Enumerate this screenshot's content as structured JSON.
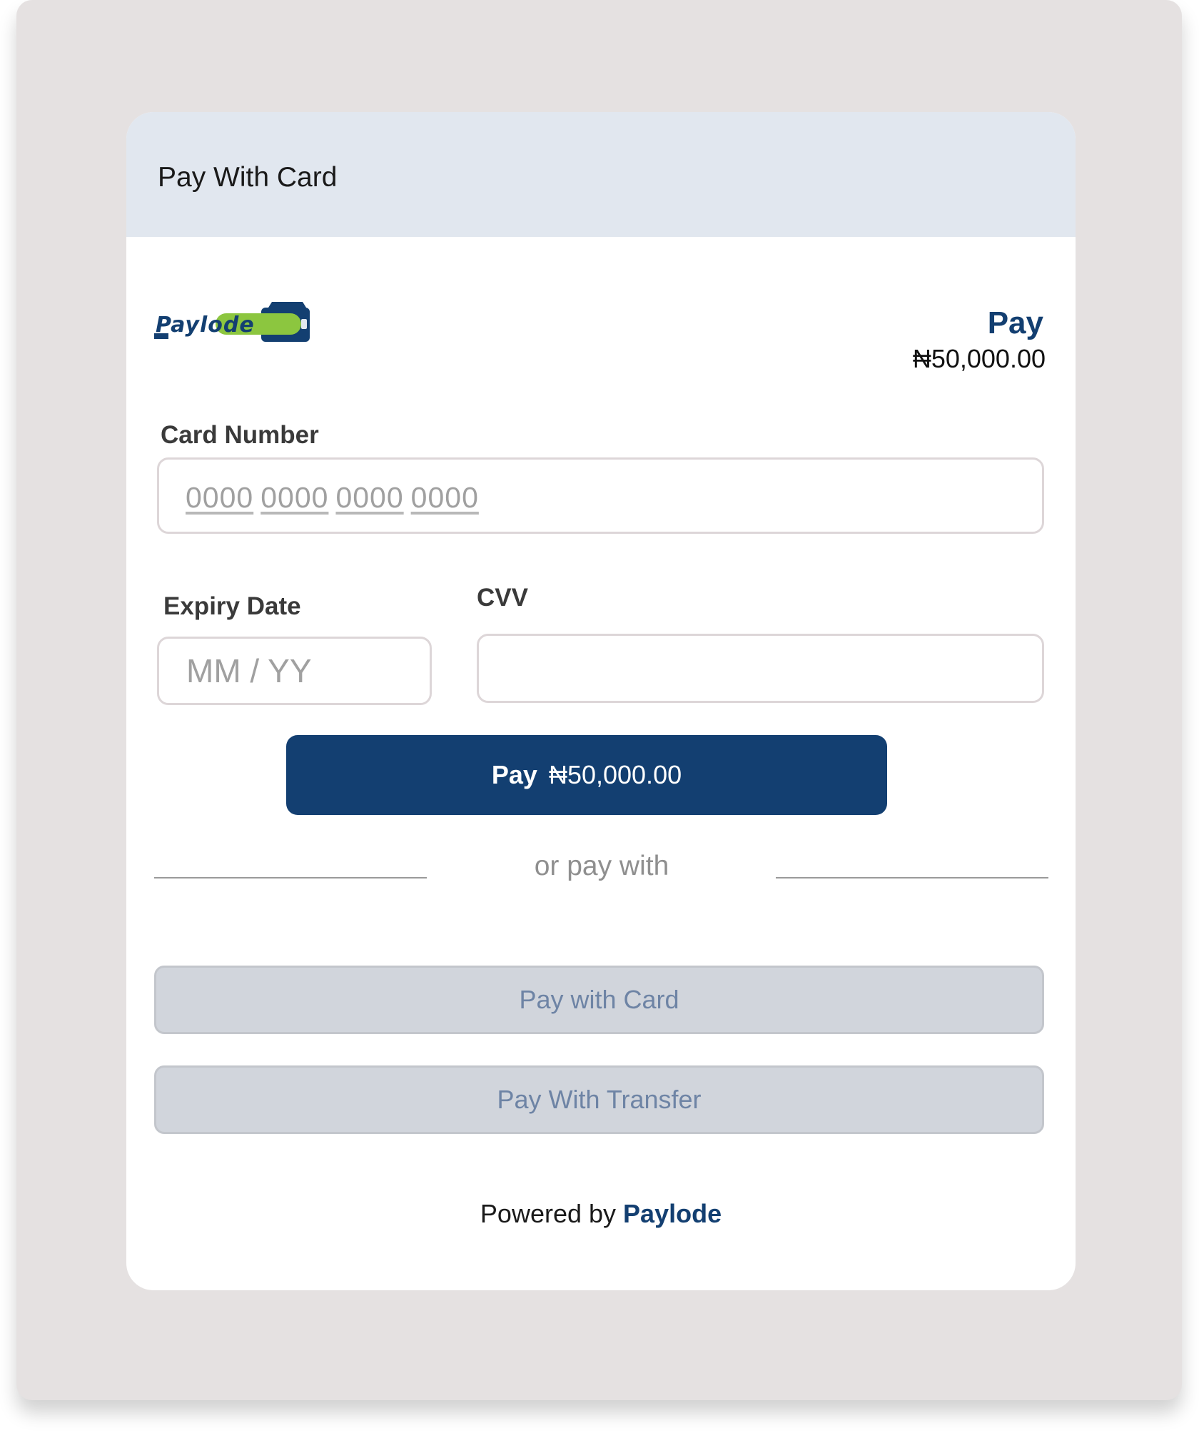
{
  "modal": {
    "title": "Pay With Card"
  },
  "brand": {
    "logo_text": "Paylode",
    "primary_color": "#133f71",
    "accent_color": "#8cc63f"
  },
  "summary": {
    "label": "Pay",
    "amount": "₦50,000.00"
  },
  "form": {
    "card_number_label": "Card Number",
    "card_number_placeholder_groups": [
      "0000",
      "0000",
      "0000",
      "0000"
    ],
    "expiry_label": "Expiry Date",
    "expiry_placeholder": "MM / YY",
    "cvv_label": "CVV",
    "cvv_value": ""
  },
  "submit": {
    "label": "Pay",
    "amount": "₦50,000.00"
  },
  "divider": {
    "text": "or pay with"
  },
  "alternatives": [
    {
      "label": "Pay with Card"
    },
    {
      "label": "Pay With Transfer"
    }
  ],
  "footer": {
    "prefix": "Powered by",
    "brand": "Paylode"
  }
}
